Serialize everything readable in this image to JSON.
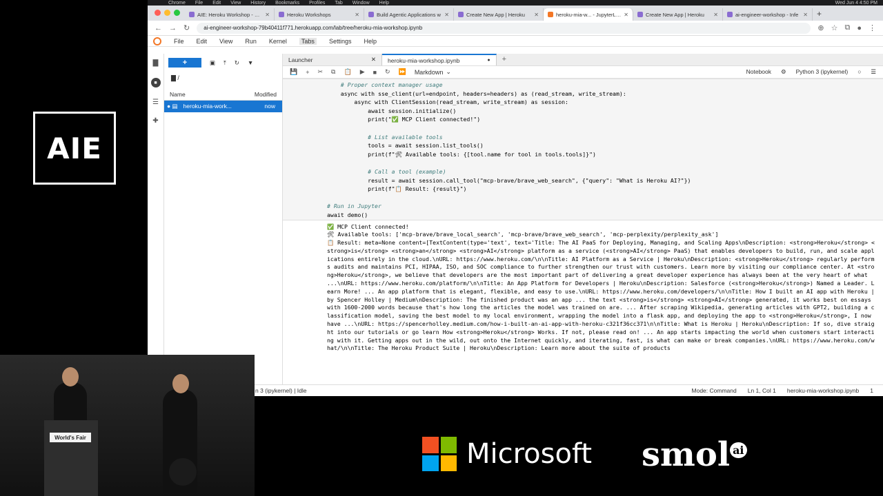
{
  "event": {
    "logo": "AIE",
    "podium_sign": "World's Fair"
  },
  "sponsors": {
    "microsoft": "Microsoft",
    "smol": "smol",
    "smol_badge": "ai"
  },
  "mac_menubar": {
    "app": "Chrome",
    "items": [
      "File",
      "Edit",
      "View",
      "History",
      "Bookmarks",
      "Profiles",
      "Tab",
      "Window",
      "Help"
    ],
    "clock": "Wed Jun 4 4:50 PM"
  },
  "browser": {
    "traffic_colors": [
      "#ff5f57",
      "#febc2e",
      "#28c840"
    ],
    "tabs": [
      {
        "label": "AIE: Heroku Workshop - Goo",
        "active": false
      },
      {
        "label": "Heroku Workshops",
        "active": false
      },
      {
        "label": "Build Agentic Applications w",
        "active": false
      },
      {
        "label": "Create New App | Heroku",
        "active": false
      },
      {
        "label": "heroku-mia-w... - JupyterLab",
        "active": true
      },
      {
        "label": "Create New App | Heroku",
        "active": false
      },
      {
        "label": "ai-engineer-workshop - Infe",
        "active": false
      }
    ],
    "url": "ai-engineer-workshop-79b40411f771.herokuapp.com/lab/tree/heroku-mia-workshop.ipynb"
  },
  "jupyter": {
    "menu": [
      "File",
      "Edit",
      "View",
      "Run",
      "Kernel",
      "Tabs",
      "Settings",
      "Help"
    ],
    "active_menu": "Tabs",
    "filebrowser": {
      "path": "/",
      "col_name": "Name",
      "col_modified": "Modified",
      "file": {
        "name": "heroku-mia-work...",
        "modified": "now"
      }
    },
    "doc_tabs": [
      {
        "label": "Launcher",
        "active": false
      },
      {
        "label": "heroku-mia-workshop.ipynb",
        "active": true
      }
    ],
    "toolbar": {
      "cell_type": "Markdown",
      "notebook_label": "Notebook",
      "kernel": "Python 3 (ipykernel)"
    },
    "status": {
      "left": "n 3 (ipykernel) | Idle",
      "mode": "Mode: Command",
      "position": "Ln 1, Col 1",
      "file": "heroku-mia-workshop.ipynb",
      "count": "1"
    },
    "code_lines": [
      "    # Proper context manager usage",
      "    async with sse_client(url=endpoint, headers=headers) as (read_stream, write_stream):",
      "        async with ClientSession(read_stream, write_stream) as session:",
      "            await session.initialize()",
      "            print(\"✅ MCP Client connected!\")",
      "",
      "            # List available tools",
      "            tools = await session.list_tools()",
      "            print(f\"🛠 Available tools: {[tool.name for tool in tools.tools]}\")",
      "",
      "            # Call a tool (example)",
      "            result = await session.call_tool(\"mcp-brave/brave_web_search\", {\"query\": \"What is Heroku AI?\"})",
      "            print(f\"📋 Result: {result}\")",
      "",
      "# Run in Jupyter",
      "await demo()"
    ],
    "output_lines": [
      "✅ MCP Client connected!",
      "🛠 Available tools: ['mcp-brave/brave_local_search', 'mcp-brave/brave_web_search', 'mcp-perplexity/perplexity_ask']"
    ],
    "output_result": "📋 Result: meta=None content=[TextContent(type='text', text='Title: The AI PaaS for Deploying, Managing, and Scaling Apps\\nDescription: <strong>Heroku</strong> <strong>is</strong> <strong>an</strong> <strong>AI</strong> platform as a service (<strong>AI</strong> PaaS) that enables developers to build, run, and scale applications entirely in the cloud.\\nURL: https://www.heroku.com/\\n\\nTitle: AI Platform as a Service | Heroku\\nDescription: <strong>Heroku</strong> regularly performs audits and maintains PCI, HIPAA, ISO, and SOC compliance to further strengthen our trust with customers. Learn more by visiting our compliance center. At <strong>Heroku</strong>, we believe that developers are the most important part of delivering a great developer experience has always been at the very heart of what ...\\nURL: https://www.heroku.com/platform/\\n\\nTitle: An App Platform for Developers | Heroku\\nDescription: Salesforce (<strong>Heroku</strong>) Named a Leader. Learn More! ... An app platform that is elegant, flexible, and easy to use.\\nURL: https://www.heroku.com/developers/\\n\\nTitle: How I built an AI app with Heroku | by Spencer Holley | Medium\\nDescription: The finished product was an app ... the text <strong>is</strong> <strong>AI</strong> generated, it works best on essays with 1600-2000 words because that's how long the articles the model was trained on are. ... After scraping Wikipedia, generating articles with GPT2, building a classification model, saving the best model to my local environment, wrapping the model into a flask app, and deploying the app to <strong>Heroku</strong>, I now have ...\\nURL: https://spencerholley.medium.com/how-i-built-an-ai-app-with-heroku-c321f36cc371\\n\\nTitle: What is Heroku | Heroku\\nDescription: If so, dive straight into our tutorials or go learn How <strong>Heroku</strong> Works. If not, please read on! ... An app starts impacting the world when customers start interacting with it. Getting apps out in the wild, out onto the Internet quickly, and iterating, fast, is what can make or break companies.\\nURL: https://www.heroku.com/what/\\n\\nTitle: The Heroku Product Suite | Heroku\\nDescription: Learn more about the suite of products"
  }
}
